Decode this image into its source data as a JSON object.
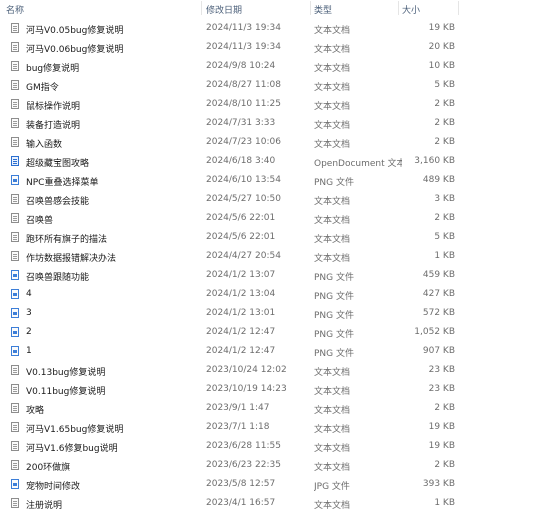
{
  "columns": {
    "name": "名称",
    "date": "修改日期",
    "type": "类型",
    "size": "大小"
  },
  "files": [
    {
      "name": "河马V0.05bug修复说明",
      "date": "2024/11/3 19:34",
      "type": "文本文档",
      "size": "19 KB",
      "icon": "text-file-icon"
    },
    {
      "name": "河马V0.06bug修复说明",
      "date": "2024/11/3 19:34",
      "type": "文本文档",
      "size": "20 KB",
      "icon": "text-file-icon"
    },
    {
      "name": "bug修复说明",
      "date": "2024/9/8 10:24",
      "type": "文本文档",
      "size": "10 KB",
      "icon": "text-file-icon"
    },
    {
      "name": "GM指令",
      "date": "2024/8/27 11:08",
      "type": "文本文档",
      "size": "5 KB",
      "icon": "text-file-icon"
    },
    {
      "name": "鼠标操作说明",
      "date": "2024/8/10 11:25",
      "type": "文本文档",
      "size": "2 KB",
      "icon": "text-file-icon"
    },
    {
      "name": "装备打造说明",
      "date": "2024/7/31 3:33",
      "type": "文本文档",
      "size": "2 KB",
      "icon": "text-file-icon"
    },
    {
      "name": "输入函数",
      "date": "2024/7/23 10:06",
      "type": "文本文档",
      "size": "2 KB",
      "icon": "text-file-icon"
    },
    {
      "name": "超级藏宝图攻略",
      "date": "2024/6/18 3:40",
      "type": "OpenDocument 文本",
      "size": "3,160 KB",
      "icon": "opendocument-file-icon"
    },
    {
      "name": "NPC重叠选择菜单",
      "date": "2024/6/10 13:54",
      "type": "PNG 文件",
      "size": "489 KB",
      "icon": "image-file-icon"
    },
    {
      "name": "召唤兽感会技能",
      "date": "2024/5/27 10:50",
      "type": "文本文档",
      "size": "3 KB",
      "icon": "text-file-icon"
    },
    {
      "name": "召唤兽",
      "date": "2024/5/6 22:01",
      "type": "文本文档",
      "size": "2 KB",
      "icon": "text-file-icon"
    },
    {
      "name": "跑环所有旗子的描法",
      "date": "2024/5/6 22:01",
      "type": "文本文档",
      "size": "5 KB",
      "icon": "text-file-icon"
    },
    {
      "name": "作坊数据报错解决办法",
      "date": "2024/4/27 20:54",
      "type": "文本文档",
      "size": "1 KB",
      "icon": "text-file-icon"
    },
    {
      "name": "召唤兽跟随功能",
      "date": "2024/1/2 13:07",
      "type": "PNG 文件",
      "size": "459 KB",
      "icon": "image-file-icon"
    },
    {
      "name": "4",
      "date": "2024/1/2 13:04",
      "type": "PNG 文件",
      "size": "427 KB",
      "icon": "image-file-icon"
    },
    {
      "name": "3",
      "date": "2024/1/2 13:01",
      "type": "PNG 文件",
      "size": "572 KB",
      "icon": "image-file-icon"
    },
    {
      "name": "2",
      "date": "2024/1/2 12:47",
      "type": "PNG 文件",
      "size": "1,052 KB",
      "icon": "image-file-icon"
    },
    {
      "name": "1",
      "date": "2024/1/2 12:47",
      "type": "PNG 文件",
      "size": "907 KB",
      "icon": "image-file-icon"
    },
    {
      "name": "V0.13bug修复说明",
      "date": "2023/10/24 12:02",
      "type": "文本文档",
      "size": "23 KB",
      "icon": "text-file-icon"
    },
    {
      "name": "V0.11bug修复说明",
      "date": "2023/10/19 14:23",
      "type": "文本文档",
      "size": "23 KB",
      "icon": "text-file-icon"
    },
    {
      "name": "攻略",
      "date": "2023/9/1 1:47",
      "type": "文本文档",
      "size": "2 KB",
      "icon": "text-file-icon"
    },
    {
      "name": "河马V1.65bug修复说明",
      "date": "2023/7/1 1:18",
      "type": "文本文档",
      "size": "19 KB",
      "icon": "text-file-icon"
    },
    {
      "name": "河马V1.6修复bug说明",
      "date": "2023/6/28 11:55",
      "type": "文本文档",
      "size": "19 KB",
      "icon": "text-file-icon"
    },
    {
      "name": "200环做旗",
      "date": "2023/6/23 22:35",
      "type": "文本文档",
      "size": "2 KB",
      "icon": "text-file-icon"
    },
    {
      "name": "宠物时间修改",
      "date": "2023/5/8 12:57",
      "type": "JPG 文件",
      "size": "393 KB",
      "icon": "image-file-icon"
    },
    {
      "name": "注册说明",
      "date": "2023/4/1 16:57",
      "type": "文本文档",
      "size": "1 KB",
      "icon": "text-file-icon"
    }
  ]
}
